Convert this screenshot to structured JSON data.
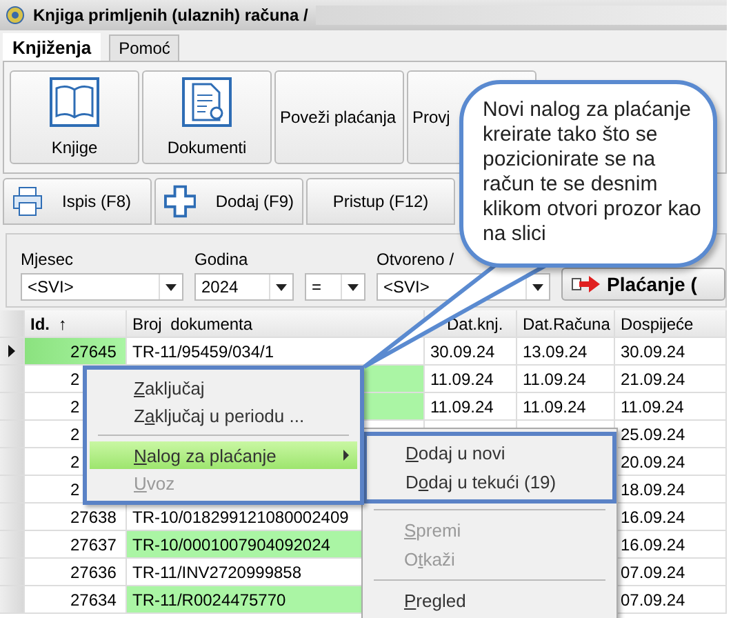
{
  "window": {
    "title": "Knjiga primljenih (ulaznih) računa /"
  },
  "tabs": [
    {
      "label": "Knjiženja",
      "selected": true
    },
    {
      "label": "Pomoć",
      "selected": false
    }
  ],
  "ribbon": [
    {
      "label": "Knjige",
      "kind": "book"
    },
    {
      "label": "Dokumenti",
      "kind": "document"
    },
    {
      "label": "Poveži plaćanja",
      "kind": "text"
    },
    {
      "label": "Provj",
      "kind": "text"
    }
  ],
  "toolbar": [
    {
      "label": "Ispis (F8)",
      "kind": "print"
    },
    {
      "label": "Dodaj (F9)",
      "kind": "add"
    },
    {
      "label": "Pristup (F12)",
      "kind": "text"
    }
  ],
  "filters": {
    "fields": [
      {
        "label": "Mjesec",
        "value": "<SVI>"
      },
      {
        "label": "Godina",
        "value": "2024"
      },
      {
        "value": "="
      },
      {
        "label": "Otvoreno /",
        "value": "<SVI>"
      }
    ],
    "action_button": "Plaćanje ("
  },
  "table": {
    "columns": [
      "**Id.** ↑",
      "Broj dokumenta",
      "Dat.knj.",
      "Dat.Računa",
      "Dospijeće"
    ],
    "rows": [
      {
        "selected": true,
        "highlighted": false,
        "id": "27645",
        "document": "TR-11/95459/034/1",
        "posted": "30.09.24",
        "invoiced": "13.09.24",
        "due": "30.09.24"
      },
      {
        "selected": false,
        "highlighted": true,
        "id": "2",
        "posted": "11.09.24",
        "invoiced": "11.09.24",
        "due": "21.09.24"
      },
      {
        "selected": false,
        "highlighted": true,
        "id": "2",
        "posted": "11.09.24",
        "invoiced": "11.09.24",
        "due": "11.09.24"
      },
      {
        "selected": false,
        "id": "2",
        "due": "25.09.24"
      },
      {
        "selected": false,
        "id": "2",
        "due": "20.09.24"
      },
      {
        "selected": false,
        "id": "2",
        "due": "18.09.24"
      },
      {
        "selected": false,
        "highlighted": false,
        "id": "27638",
        "document": "TR-10/018299121080002409",
        "due": "16.09.24"
      },
      {
        "selected": false,
        "highlighted": true,
        "id": "27637",
        "document": "TR-10/0001007904092024",
        "due": "16.09.24"
      },
      {
        "selected": false,
        "highlighted": false,
        "id": "27636",
        "document": "TR-11/INV2720999858",
        "due": "07.09.24"
      },
      {
        "selected": false,
        "highlighted": true,
        "id": "27634",
        "document": "TR-11/R0024475770",
        "due": "07.09.24"
      }
    ]
  },
  "context_menu": {
    "items": [
      {
        "kind": "item",
        "key": "Z",
        "rest": "aključaj",
        "disabled": false,
        "selected": false,
        "submenu": false
      },
      {
        "kind": "item",
        "lead": "Z",
        "key": "a",
        "rest": "ključaj u periodu ...",
        "disabled": false,
        "selected": false,
        "submenu": false
      },
      {
        "kind": "separator"
      },
      {
        "kind": "item",
        "key": "N",
        "rest": "alog za plaćanje",
        "disabled": false,
        "selected": true,
        "submenu": true
      },
      {
        "kind": "item",
        "key": "U",
        "rest": "voz",
        "disabled": true,
        "selected": false,
        "submenu": false
      }
    ]
  },
  "submenu": {
    "items": [
      {
        "kind": "item",
        "key": "D",
        "rest": "odaj u novi",
        "disabled": false,
        "framed": true
      },
      {
        "kind": "item",
        "lead": "D",
        "key": "o",
        "rest": "daj u tekući (19)",
        "disabled": false,
        "framed": true
      },
      {
        "kind": "separator"
      },
      {
        "kind": "item",
        "key": "S",
        "rest": "premi",
        "disabled": true,
        "framed": false
      },
      {
        "kind": "item",
        "lead": "O",
        "key": "t",
        "rest": "kaži",
        "disabled": true,
        "framed": false
      },
      {
        "kind": "separator"
      },
      {
        "kind": "item",
        "key": "P",
        "rest": "regled",
        "disabled": false,
        "framed": false
      }
    ]
  },
  "callout": {
    "text": "Novi nalog za plaćanje kreirate tako što se pozicionirate se na račun te se desnim klikom otvori prozor kao na slici"
  }
}
